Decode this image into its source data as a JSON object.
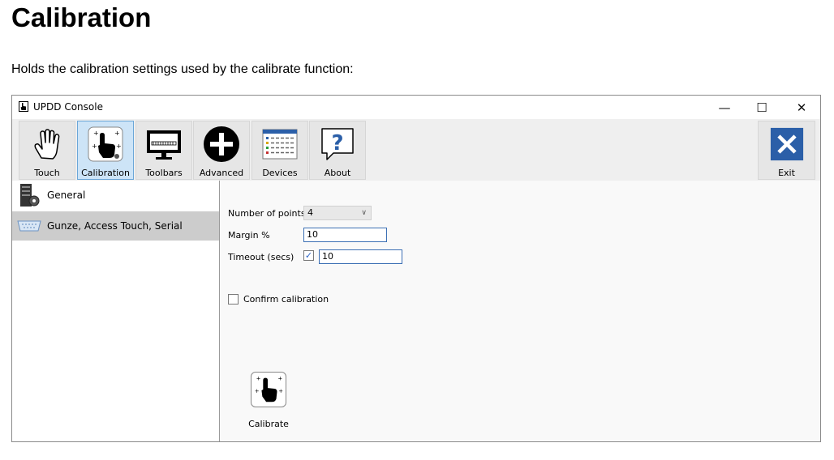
{
  "doc": {
    "title": "Calibration",
    "description": "Holds the calibration settings used by the calibrate function:"
  },
  "window": {
    "title": "UPDD Console",
    "controls": {
      "minimize": "—",
      "maximize": "☐",
      "close": "✕"
    }
  },
  "toolbar": {
    "items": [
      {
        "label": "Touch",
        "icon": "touch-hand-icon"
      },
      {
        "label": "Calibration",
        "icon": "calibration-icon",
        "active": true
      },
      {
        "label": "Toolbars",
        "icon": "toolbars-monitor-icon"
      },
      {
        "label": "Advanced",
        "icon": "plus-circle-icon"
      },
      {
        "label": "Devices",
        "icon": "devices-list-icon"
      },
      {
        "label": "About",
        "icon": "question-icon"
      }
    ],
    "exit_label": "Exit",
    "exit_icon": "close-x-icon"
  },
  "sidebar": {
    "items": [
      {
        "label": "General",
        "icon": "server-gear-icon"
      },
      {
        "label": "Gunze, Access Touch, Serial",
        "icon": "serial-port-icon",
        "selected": true
      }
    ]
  },
  "settings": {
    "points_label": "Number of points",
    "points_value": "4",
    "margin_label": "Margin %",
    "margin_value": "10",
    "timeout_label": "Timeout (secs)",
    "timeout_checked": true,
    "timeout_value": "10",
    "confirm_label": "Confirm calibration",
    "confirm_checked": false
  },
  "calibrate": {
    "label": "Calibrate",
    "icon": "calibrate-hand-icon"
  },
  "colors": {
    "accent": "#2a63c6",
    "selected_row": "#cccccc",
    "exit_blue": "#2b5fa8"
  }
}
